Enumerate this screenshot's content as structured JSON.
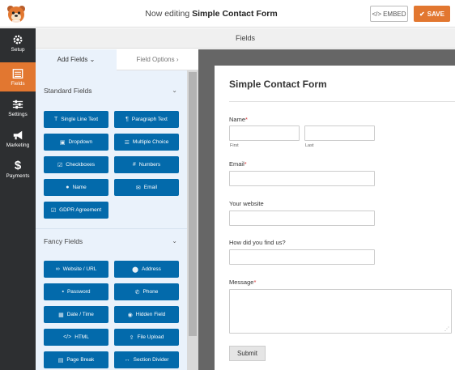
{
  "header": {
    "editing_prefix": "Now editing",
    "form_name": "Simple Contact Form",
    "embed_label": "EMBED",
    "save_label": "SAVE"
  },
  "sidebar": {
    "items": [
      {
        "label": "Setup",
        "icon": "gear-icon"
      },
      {
        "label": "Fields",
        "icon": "list-icon"
      },
      {
        "label": "Settings",
        "icon": "sliders-icon"
      },
      {
        "label": "Marketing",
        "icon": "megaphone-icon"
      },
      {
        "label": "Payments",
        "icon": "dollar-icon"
      }
    ]
  },
  "subheader": {
    "title": "Fields"
  },
  "panel": {
    "tabs": {
      "add_fields": "Add Fields",
      "field_options": "Field Options"
    },
    "standard": {
      "title": "Standard Fields",
      "fields": [
        "Single Line Text",
        "Paragraph Text",
        "Dropdown",
        "Multiple Choice",
        "Checkboxes",
        "Numbers",
        "Name",
        "Email",
        "GDPR Agreement"
      ]
    },
    "fancy": {
      "title": "Fancy Fields",
      "fields": [
        "Website / URL",
        "Address",
        "Password",
        "Phone",
        "Date / Time",
        "Hidden Field",
        "HTML",
        "File Upload",
        "Page Break",
        "Section Divider"
      ]
    }
  },
  "form": {
    "title": "Simple Contact Form",
    "name_label": "Name",
    "first_label": "First",
    "last_label": "Last",
    "email_label": "Email",
    "website_label": "Your website",
    "find_label": "How did you find us?",
    "message_label": "Message",
    "required_mark": "*",
    "submit_label": "Submit"
  },
  "colors": {
    "accent": "#e27730",
    "field_button": "#036aab",
    "sidebar": "#2d2f31"
  }
}
